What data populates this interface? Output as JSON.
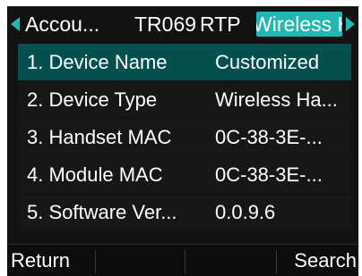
{
  "tabs": [
    "Accou...",
    "TR069",
    "RTP",
    "Wireless H"
  ],
  "list": [
    {
      "label": "1. Device Name",
      "value": "Customized"
    },
    {
      "label": "2. Device Type",
      "value": "Wireless Ha..."
    },
    {
      "label": "3. Handset MAC",
      "value": "0C-38-3E-..."
    },
    {
      "label": "4. Module MAC",
      "value": "0C-38-3E-..."
    },
    {
      "label": "5. Software Ver...",
      "value": "0.0.9.6"
    }
  ],
  "softkeys": [
    "Return",
    "",
    "",
    "Search"
  ],
  "colors": {
    "accent": "#23b7b4",
    "selected_row": "#03504f",
    "background": "#121212"
  }
}
